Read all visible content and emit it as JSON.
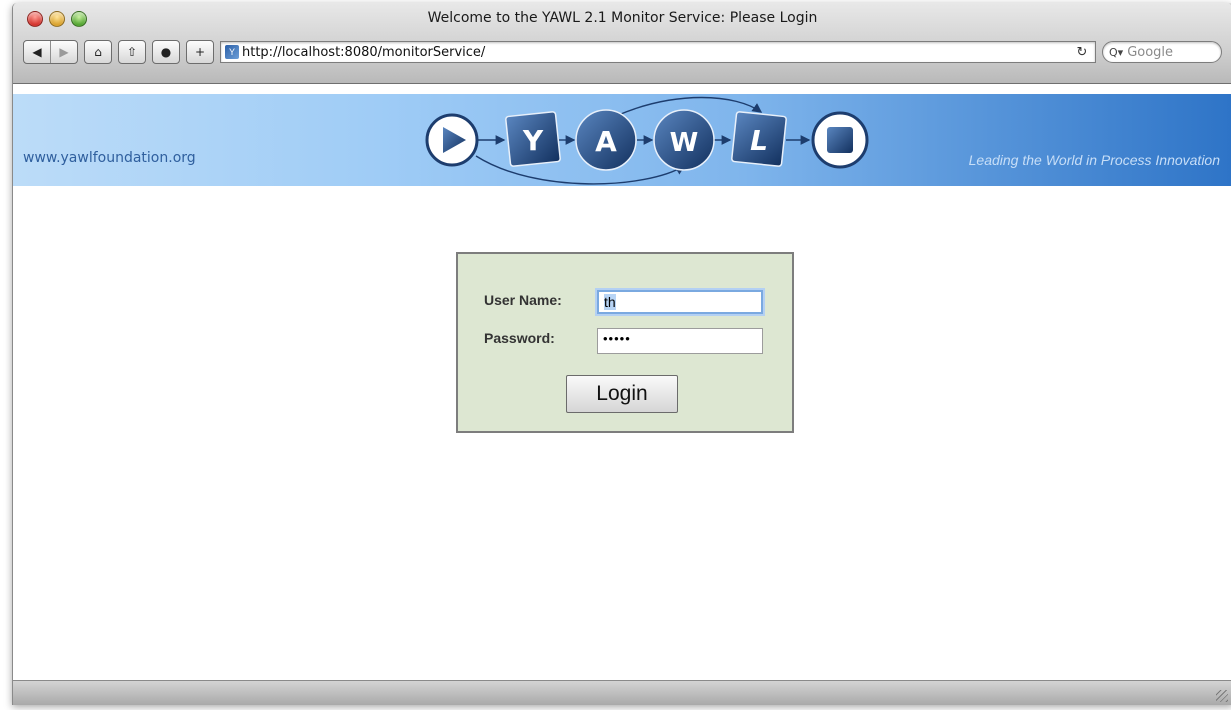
{
  "window": {
    "title": "Welcome to the YAWL 2.1 Monitor Service: Please Login"
  },
  "toolbar": {
    "back_icon": "◀",
    "forward_icon": "▶",
    "home_icon": "⌂",
    "bookmark_icon": "⇧",
    "download_icon": "●",
    "add_icon": "+",
    "favicon_glyph": "Y",
    "url": "http://localhost:8080/monitorService/",
    "reload_icon": "↻",
    "search_icon": "Q▾",
    "search_placeholder": "Google"
  },
  "banner": {
    "site_link": "www.yawlfoundation.org",
    "tagline": "Leading the World in Process Innovation",
    "logo_letters": [
      "Y",
      "A",
      "W",
      "L"
    ]
  },
  "login": {
    "username_label": "User Name:",
    "username_value": "th",
    "password_label": "Password:",
    "password_value": "•••••",
    "button_label": "Login"
  },
  "colors": {
    "banner_light": "#bcdcf8",
    "banner_dark": "#2e74c7",
    "login_panel": "#dde7d2",
    "logo_navy": "#1d3d6e"
  }
}
